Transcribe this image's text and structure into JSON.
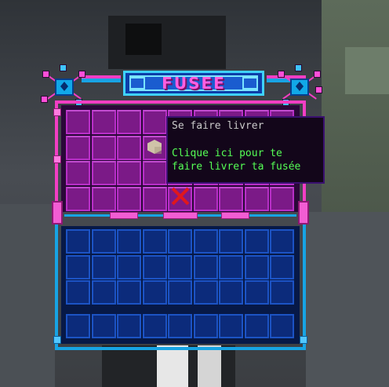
{
  "gui": {
    "title": "FUSEE"
  },
  "tooltip": {
    "title": "Se faire livrer",
    "line1": "Clique ici pour te",
    "line2": "faire livrer ta fusée"
  },
  "items": {
    "block": "sandstone-block-icon",
    "cancel": "red-x-icon"
  },
  "colors": {
    "frame_pink": "#f23ec4",
    "frame_blue": "#17a4e4",
    "slot_pink": "#7b1a87",
    "slot_blue": "#0c2b7b",
    "title_text": "#ff5fe0",
    "tooltip_green": "#55ff55",
    "cancel_red": "#e0171c"
  }
}
